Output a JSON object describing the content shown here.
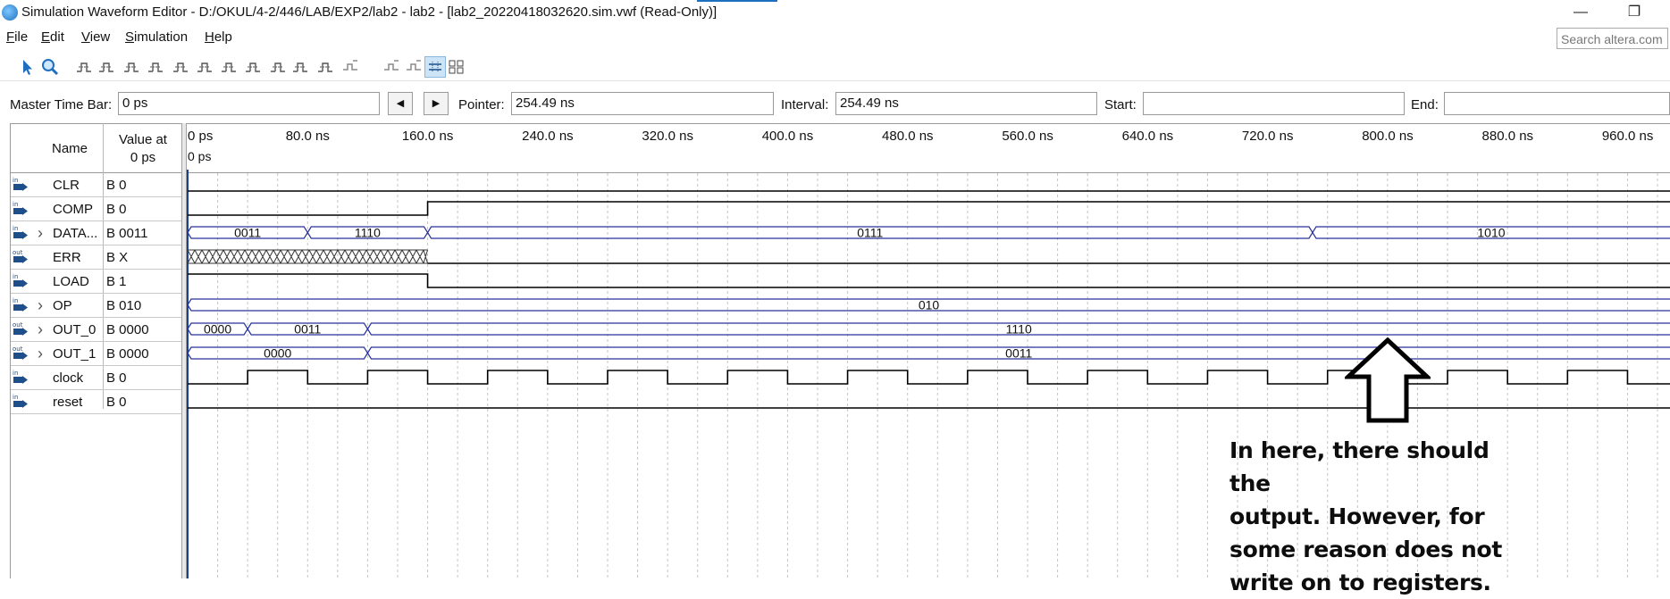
{
  "window": {
    "title": "Simulation Waveform Editor - D:/OKUL/4-2/446/LAB/EXP2/lab2 - lab2 - [lab2_20220418032620.sim.vwf (Read-Only)]",
    "minimize_glyph": "—",
    "restore_glyph": "❐"
  },
  "menu": {
    "items": [
      {
        "u": "F",
        "rest": "ile"
      },
      {
        "u": "E",
        "rest": "dit"
      },
      {
        "u": "V",
        "rest": "iew"
      },
      {
        "u": "S",
        "rest": "imulation"
      },
      {
        "u": "H",
        "rest": "elp"
      }
    ]
  },
  "search": {
    "placeholder": "Search altera.com"
  },
  "toolbar": {
    "icons": [
      "selection-tool-icon",
      "zoom-tool-icon",
      "forcing-unknown-icon",
      "forcing-low-icon",
      "forcing-high-icon",
      "high-impedance-icon",
      "weak-low-icon",
      "weak-high-icon",
      "invert-icon",
      "count-value-icon",
      "clock-value-icon",
      "arbitrary-value-icon",
      "random-value-icon",
      "overwrite-clock-icon",
      "insert-time-icon",
      "delete-time-icon",
      "snap-to-grid-icon",
      "grid-icon"
    ]
  },
  "timebar": {
    "master_label": "Master Time Bar:",
    "master_value": "0 ps",
    "prev_glyph": "◀",
    "next_glyph": "▶",
    "pointer_label": "Pointer:",
    "pointer_value": "254.49 ns",
    "interval_label": "Interval:",
    "interval_value": "254.49 ns",
    "start_label": "Start:",
    "start_value": "",
    "end_label": "End:",
    "end_value": ""
  },
  "signal_table": {
    "header_name": "Name",
    "header_value_line1": "Value at",
    "header_value_line2": "0 ps",
    "signals": [
      {
        "name": "CLR",
        "value": "B 0",
        "dir": "in",
        "bus": false
      },
      {
        "name": "COMP",
        "value": "B 0",
        "dir": "in",
        "bus": false
      },
      {
        "name": "DATA...",
        "value": "B 0011",
        "dir": "in",
        "bus": true
      },
      {
        "name": "ERR",
        "value": "B X",
        "dir": "out",
        "bus": false
      },
      {
        "name": "LOAD",
        "value": "B 1",
        "dir": "in",
        "bus": false
      },
      {
        "name": "OP",
        "value": "B 010",
        "dir": "in",
        "bus": true
      },
      {
        "name": "OUT_0",
        "value": "B 0000",
        "dir": "out",
        "bus": true
      },
      {
        "name": "OUT_1",
        "value": "B 0000",
        "dir": "out",
        "bus": true
      },
      {
        "name": "clock",
        "value": "B 0",
        "dir": "in",
        "bus": false
      },
      {
        "name": "reset",
        "value": "B 0",
        "dir": "in",
        "bus": false
      }
    ]
  },
  "timeline": {
    "ticks": [
      "0 ps",
      "80.0 ns",
      "160.0 ns",
      "240.0 ns",
      "320.0 ns",
      "400.0 ns",
      "480.0 ns",
      "560.0 ns",
      "640.0 ns",
      "720.0 ns",
      "800.0 ns",
      "880.0 ns",
      "960.0 ns"
    ],
    "cursor_label": "0 ps"
  },
  "waveforms": {
    "time_unit": "ns",
    "clock_period_ns": 80,
    "CLR": [
      [
        0,
        0
      ]
    ],
    "COMP": [
      [
        0,
        0
      ],
      [
        160,
        1
      ]
    ],
    "LOAD": [
      [
        0,
        1
      ],
      [
        160,
        0
      ]
    ],
    "reset": [
      [
        0,
        0
      ]
    ],
    "ERR": {
      "unknown_until_ns": 160,
      "then": 0
    },
    "DATA": [
      {
        "from": 0,
        "to": 80,
        "label": "0011"
      },
      {
        "from": 80,
        "to": 160,
        "label": "1110"
      },
      {
        "from": 160,
        "to": 750,
        "label": "0111"
      },
      {
        "from": 750,
        "to": 1000,
        "label": "1010"
      }
    ],
    "OP": [
      {
        "from": 0,
        "to": 1000,
        "label": "010"
      }
    ],
    "OUT_0": [
      {
        "from": 0,
        "to": 40,
        "label": "0000"
      },
      {
        "from": 40,
        "to": 120,
        "label": "0011"
      },
      {
        "from": 120,
        "to": 1000,
        "label": "1110"
      }
    ],
    "OUT_1": [
      {
        "from": 0,
        "to": 120,
        "label": "0000"
      },
      {
        "from": 120,
        "to": 1000,
        "label": "0011"
      }
    ]
  },
  "annotation": {
    "lines": [
      "In here, there should the",
      "output. However, for",
      "some reason does not",
      "write on to registers."
    ]
  }
}
